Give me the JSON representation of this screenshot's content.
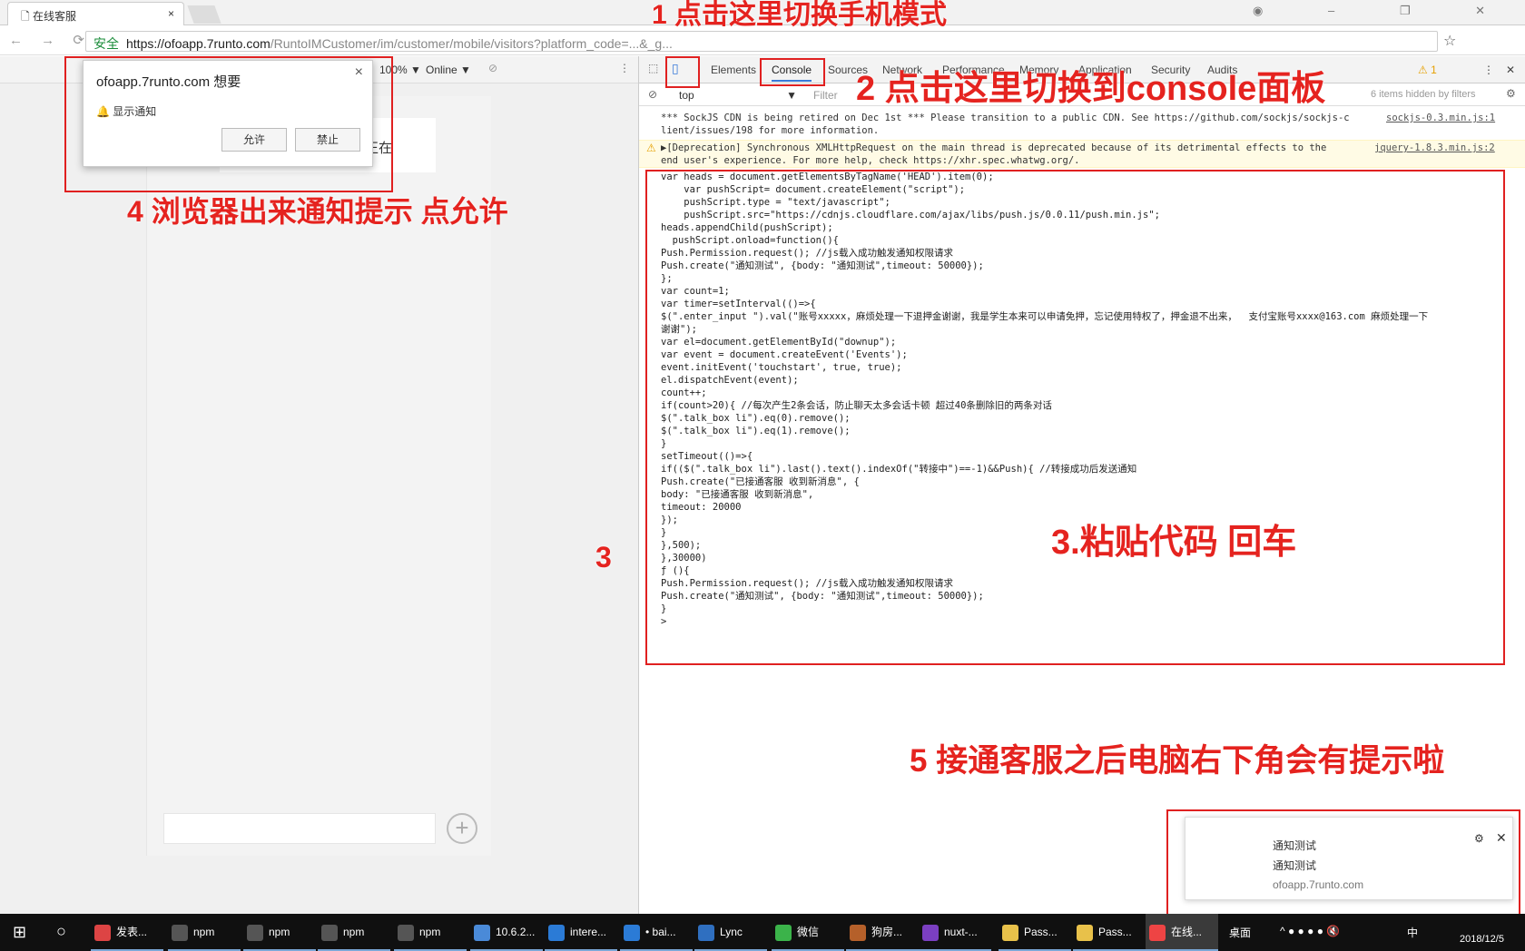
{
  "browser": {
    "tab_title": "在线客服",
    "url_secure": "安全",
    "url_host": "https://ofoapp.7runto.com",
    "url_path": "/RuntoIMCustomer/im/customer/mobile/visitors?platform_code=...&_g..."
  },
  "device_toolbar": {
    "zoom": "100% ▼",
    "network": "Online ▼"
  },
  "phone": {
    "message": "正在",
    "plus": "+"
  },
  "permission_dialog": {
    "title": "ofoapp.7runto.com 想要",
    "item": "显示通知",
    "allow": "允许",
    "block": "禁止"
  },
  "devtools": {
    "tabs": [
      "Elements",
      "Console",
      "Sources",
      "Network",
      "Performance",
      "Memory",
      "Application",
      "Security",
      "Audits"
    ],
    "active_tab": "Console",
    "warnings": "⚠ 1",
    "context": "top",
    "filter_placeholder": "Filter",
    "hidden": "6 items hidden by filters",
    "msg1_line1": "*** SockJS CDN is being retired on Dec 1st *** Please transition to a public CDN. See https://github.com/sockjs/sockjs-c",
    "msg1_line2": "lient/issues/198 for more information.",
    "msg1_src": "sockjs-0.3.min.js:1",
    "msg2_line1": "▶[Deprecation] Synchronous XMLHttpRequest on the main thread is deprecated because of its detrimental effects to the",
    "msg2_line2": "end user's experience. For more help, check https://xhr.spec.whatwg.org/.",
    "msg2_src": "jquery-1.8.3.min.js:2",
    "code": [
      "var heads = document.getElementsByTagName('HEAD').item(0);",
      "    var pushScript= document.createElement(\"script\");",
      "    pushScript.type = \"text/javascript\";",
      "    pushScript.src=\"https://cdnjs.cloudflare.com/ajax/libs/push.js/0.0.11/push.min.js\";",
      "heads.appendChild(pushScript);",
      "  pushScript.onload=function(){",
      "Push.Permission.request(); //js载入成功触发通知权限请求",
      "Push.create(\"通知测试\", {body: \"通知测试\",timeout: 50000});",
      "};",
      "var count=1;",
      "var timer=setInterval(()=>{",
      "$(\".enter_input \").val(\"账号xxxxx，麻烦处理一下退押金谢谢，我是学生本来可以申请免押，忘记使用特权了，押金退不出来，  支付宝账号xxxx@163.com 麻烦处理一下",
      "谢谢\");",
      "var el=document.getElementById(\"downup\");",
      "var event = document.createEvent('Events');",
      "event.initEvent('touchstart', true, true);",
      "el.dispatchEvent(event);",
      "count++;",
      "if(count>20){ //每次产生2条会话，防止聊天太多会话卡顿 超过40条删除旧的两条对话",
      "$(\".talk_box li\").eq(0).remove();",
      "$(\".talk_box li\").eq(1).remove();",
      "}",
      "setTimeout(()=>{",
      "if(($(\".talk_box li\").last().text().indexOf(\"转接中\")==-1)&&Push){ //转接成功后发送通知",
      "Push.create(\"已接通客服 收到新消息\", {",
      "body: \"已接通客服 收到新消息\",",
      "timeout: 20000",
      "});",
      "}",
      "},500);",
      "},30000)",
      "ƒ (){",
      "Push.Permission.request(); //js载入成功触发通知权限请求",
      "Push.create(\"通知测试\", {body: \"通知测试\",timeout: 50000});",
      "}",
      ">"
    ]
  },
  "annotations": {
    "step1": "1 点击这里切换手机模式",
    "step2": "2 点击这里切换到console面板",
    "step3_small": "3",
    "step3": "3.粘贴代码 回车",
    "step4": "4 浏览器出来通知提示 点允许",
    "step5": "5 接通客服之后电脑右下角会有提示啦"
  },
  "toast": {
    "title": "通知测试",
    "body": "通知测试",
    "source": "ofoapp.7runto.com"
  },
  "taskbar": {
    "items": [
      "发表...",
      "npm",
      "npm",
      "npm",
      "npm",
      "10.6.2...",
      "intere...",
      "• bai...",
      "Lync",
      "微信",
      "狗房...",
      "nuxt-...",
      "Pass...",
      "Pass...",
      "在线..."
    ],
    "desktop": "桌面",
    "ime": "中",
    "time": "2018/12/5"
  },
  "colors": {
    "annotation": "#e5231f",
    "accent": "#3879d9"
  }
}
